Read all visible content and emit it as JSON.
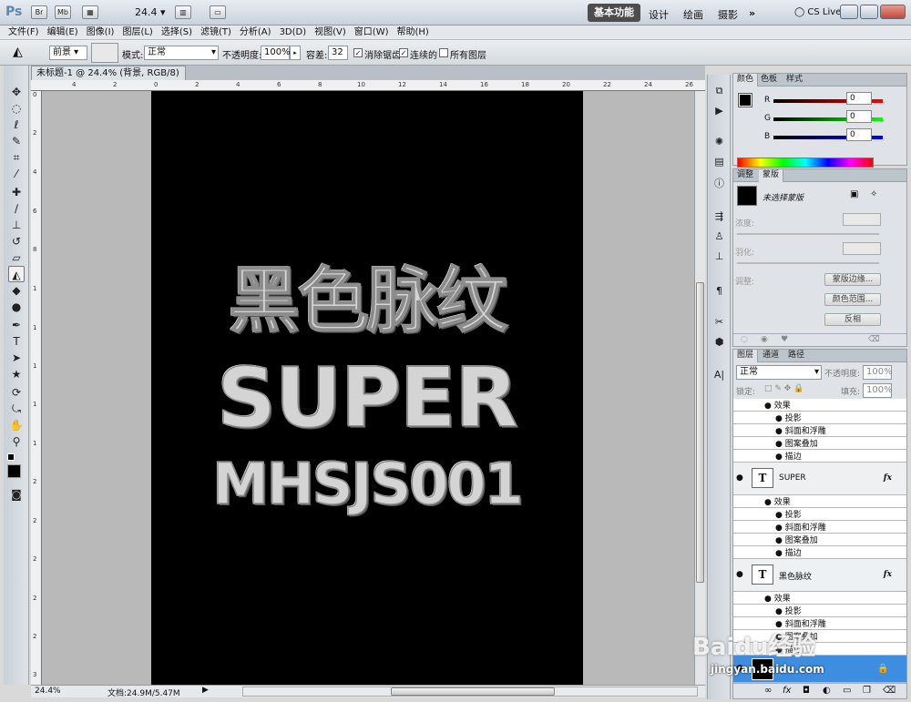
{
  "app": {
    "logo": "Ps",
    "zoom": "24.4",
    "workspaces": [
      "基本功能",
      "设计",
      "绘画",
      "摄影"
    ],
    "more": "»",
    "cs_live": "CS Live"
  },
  "menu": [
    "文件(F)",
    "编辑(E)",
    "图像(I)",
    "图层(L)",
    "选择(S)",
    "滤镜(T)",
    "分析(A)",
    "3D(D)",
    "视图(V)",
    "窗口(W)",
    "帮助(H)"
  ],
  "options": {
    "fill_source": "前景",
    "mode_label": "模式:",
    "mode_value": "正常",
    "opacity_label": "不透明度:",
    "opacity_value": "100%",
    "tolerance_label": "容差:",
    "tolerance_value": "32",
    "antialias_label": "消除锯齿",
    "contiguous_label": "连续的",
    "all_layers_label": "所有图层"
  },
  "document": {
    "tab_title": "未标题-1 @ 24.4% (背景, RGB/8) *",
    "close": "×"
  },
  "ruler": {
    "h": [
      "4",
      "2",
      "0",
      "2",
      "4",
      "6",
      "8",
      "10",
      "12",
      "14",
      "16",
      "18",
      "20",
      "22",
      "24",
      "26"
    ],
    "v": [
      "0",
      "2",
      "4",
      "6",
      "8",
      "1",
      "1",
      "1",
      "1",
      "1",
      "2",
      "2",
      "2",
      "2",
      "2",
      "3",
      "3"
    ]
  },
  "canvas": {
    "line1": "黑色脉纹",
    "line2": "SUPER",
    "line3": "MHSJS001"
  },
  "status": {
    "zoom": "24.4%",
    "doc": "文档:24.9M/5.47M"
  },
  "color_panel": {
    "tabs": [
      "颜色",
      "色板",
      "样式"
    ],
    "r_label": "R",
    "g_label": "G",
    "b_label": "B",
    "r": "0",
    "g": "0",
    "b": "0"
  },
  "adjust_panel": {
    "tabs": [
      "调整",
      "蒙版"
    ],
    "no_mask": "未选择蒙版",
    "density": "浓度:",
    "feather": "羽化:",
    "refine": "调整:",
    "mask_edge": "蒙版边缘...",
    "color_range": "颜色范围...",
    "invert": "反相"
  },
  "layers_panel": {
    "tabs": [
      "图层",
      "通道",
      "路径"
    ],
    "blend": "正常",
    "opacity_label": "不透明度:",
    "opacity": "100%",
    "lock_label": "锁定:",
    "fill_label": "填充:",
    "fill": "100%",
    "effects_label": "效果",
    "effects": [
      "投影",
      "斜面和浮雕",
      "图案叠加",
      "描边"
    ],
    "layers": [
      {
        "name": "SUPER"
      },
      {
        "name": "黑色脉纹"
      }
    ],
    "fx": "fx"
  },
  "watermark": {
    "brand": "Baidu经验",
    "url": "jingyan.baidu.com"
  }
}
